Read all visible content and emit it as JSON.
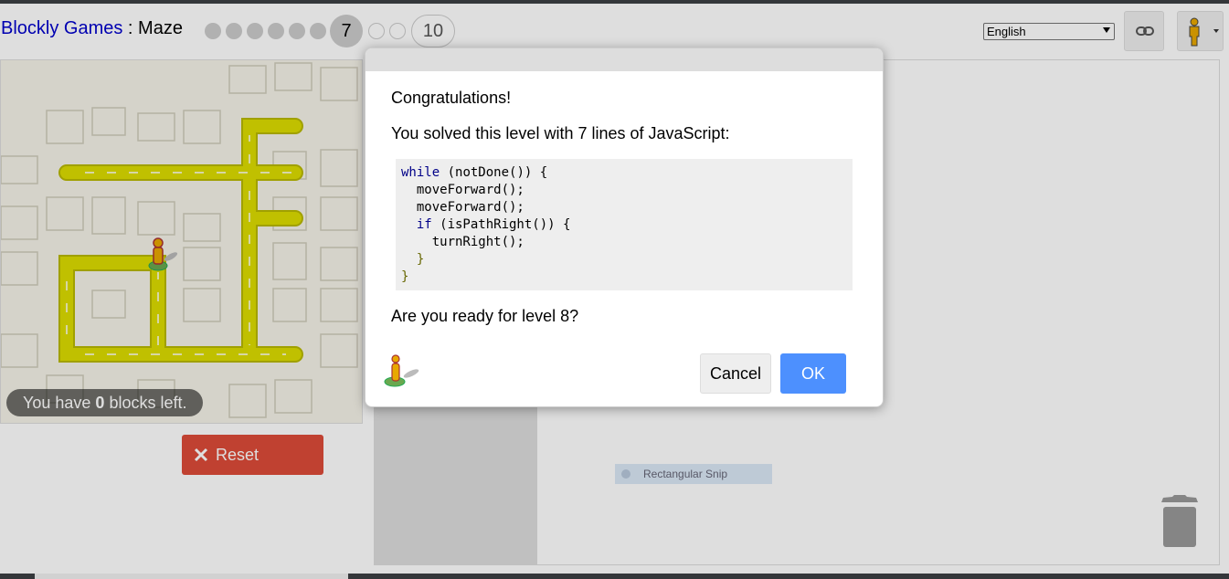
{
  "header": {
    "app_link": "Blockly Games",
    "separator": " : ",
    "game": "Maze",
    "current_level": "7",
    "last_level": "10",
    "language": "English"
  },
  "maze": {
    "blocks_left_prefix": "You have ",
    "blocks_left_count": "0",
    "blocks_left_suffix": " blocks left."
  },
  "controls": {
    "reset_label": "Reset"
  },
  "workspace": {
    "snip_label": "Rectangular Snip"
  },
  "dialog": {
    "congrats": "Congratulations!",
    "solved": "You solved this level with 7 lines of JavaScript:",
    "ready": "Are you ready for level 8?",
    "cancel_label": "Cancel",
    "ok_label": "OK",
    "code": {
      "kw_while": "while",
      "while_rest": " (notDone()) {",
      "line2": "  moveForward();",
      "line3": "  moveForward();",
      "kw_if": "if",
      "if_rest": " (isPathRight()) {",
      "line5": "    turnRight();",
      "line6": "  }",
      "line7": "}"
    }
  },
  "colors": {
    "link": "#0000cc",
    "reset": "#dd4b39",
    "ok": "#4d90fe",
    "path": "#dddd00"
  }
}
